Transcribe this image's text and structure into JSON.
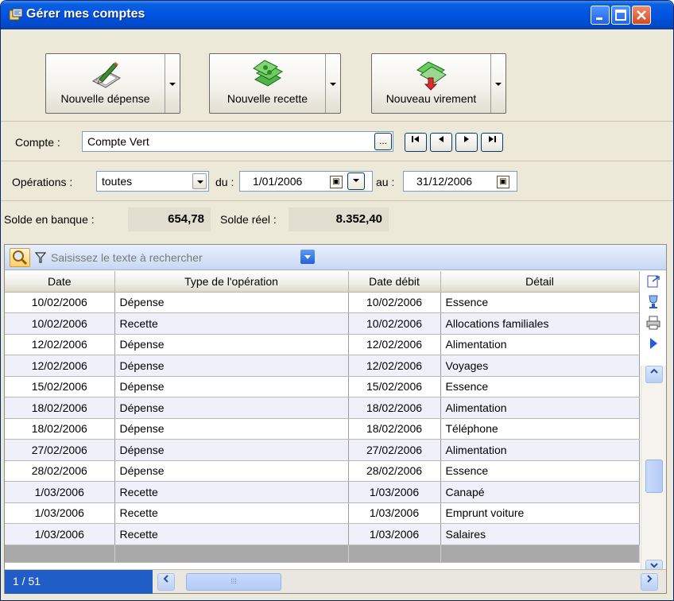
{
  "window": {
    "title": "Gérer mes comptes",
    "title_icon": "app-icon",
    "controls": [
      "minimize-icon",
      "maximize-icon",
      "close-icon"
    ]
  },
  "toolbar": {
    "buttons": [
      {
        "label": "Nouvelle dépense",
        "icon": "pencil-notepad-icon"
      },
      {
        "label": "Nouvelle recette",
        "icon": "money-stack-icon"
      },
      {
        "label": "Nouveau virement",
        "icon": "money-transfer-icon"
      }
    ]
  },
  "account": {
    "label": "Compte :",
    "value": "Compte Vert",
    "browse_label": "...",
    "nav": [
      "first-record-icon",
      "previous-record-icon",
      "next-record-icon",
      "last-record-icon"
    ]
  },
  "operations": {
    "label": "Opérations :",
    "filter_value": "toutes",
    "from_label": "du :",
    "from_date": "1/01/2006",
    "to_label": "au :",
    "to_date": "31/12/2006"
  },
  "balance": {
    "bank_label": "Solde en banque :",
    "bank_value": "654,78",
    "real_label": "Solde réel :",
    "real_value": "8.352,40"
  },
  "search": {
    "placeholder": "Saisissez le texte à rechercher"
  },
  "table": {
    "columns": [
      "Date",
      "Type de l'opération",
      "Date débit",
      "Détail"
    ],
    "rows": [
      [
        "10/02/2006",
        "Dépense",
        "10/02/2006",
        "Essence"
      ],
      [
        "10/02/2006",
        "Recette",
        "10/02/2006",
        "Allocations familiales"
      ],
      [
        "12/02/2006",
        "Dépense",
        "12/02/2006",
        "Alimentation"
      ],
      [
        "12/02/2006",
        "Dépense",
        "12/02/2006",
        "Voyages"
      ],
      [
        "15/02/2006",
        "Dépense",
        "15/02/2006",
        "Essence"
      ],
      [
        "18/02/2006",
        "Dépense",
        "18/02/2006",
        "Alimentation"
      ],
      [
        "18/02/2006",
        "Dépense",
        "18/02/2006",
        "Téléphone"
      ],
      [
        "27/02/2006",
        "Dépense",
        "27/02/2006",
        "Alimentation"
      ],
      [
        "28/02/2006",
        "Dépense",
        "28/02/2006",
        "Essence"
      ],
      [
        "1/03/2006",
        "Recette",
        "1/03/2006",
        "Canapé"
      ],
      [
        "1/03/2006",
        "Recette",
        "1/03/2006",
        "Emprunt voiture"
      ],
      [
        "1/03/2006",
        "Recette",
        "1/03/2006",
        "Salaires"
      ]
    ]
  },
  "status": {
    "record_count": "1 / 51"
  }
}
